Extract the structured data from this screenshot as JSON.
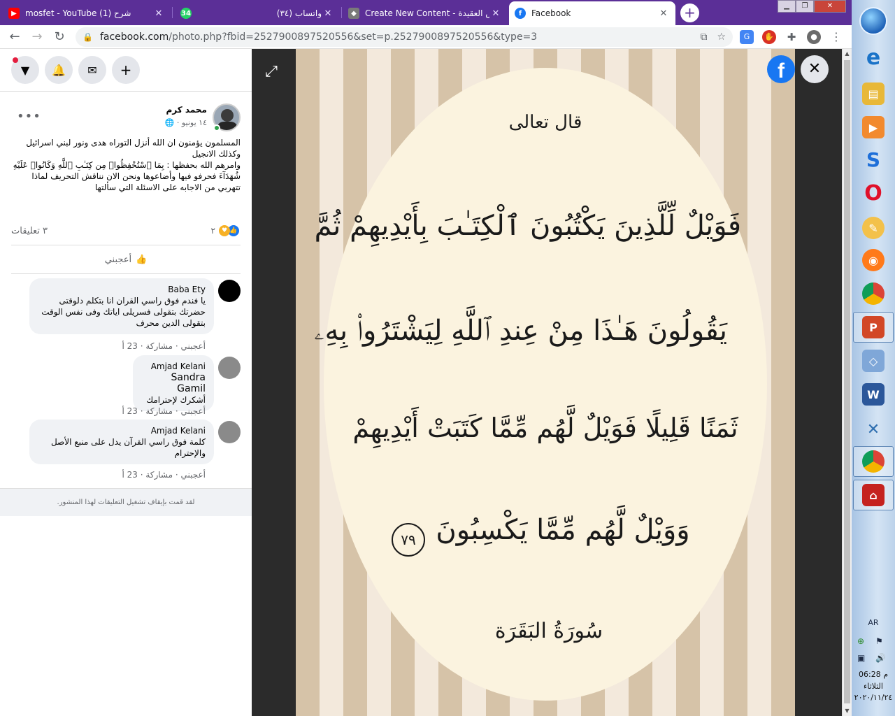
{
  "browser": {
    "tabs": [
      {
        "title": "mosfet - YouTube (1) شرح",
        "icon": "youtube-icon",
        "color": "#ff0000"
      },
      {
        "title": "(٣٤) واتساب",
        "icon": "whatsapp-icon",
        "color": "#25d366"
      },
      {
        "title": "Create New Content - حراس العقيدة",
        "icon": "site-icon",
        "color": "#7a7a7a"
      },
      {
        "title": "Facebook",
        "icon": "facebook-icon",
        "color": "#1877f2"
      }
    ],
    "new_tab": "+",
    "url_host": "facebook.com",
    "url_path": "/photo.php?fbid=2527900897520556&set=p.2527900897520556&type=3"
  },
  "post": {
    "author": "محمد كرم",
    "date": "١٤ يونيو ·",
    "text_lines": [
      "المسلمون يؤمنون ان الله أنزل التوراه هدى ونور لبني اسرائيل وكذلك الانجيل",
      "وامرهم الله بحفظها : بِمَا ٱسْتُحْفِظُوا۟ مِن كِتَـٰبِ ٱللَّهِ وَكَانُوا۟ عَلَيْهِ شُهَدَآءَ فحرفو فيها وأضاعوها ونحن الان نناقش التحريف لماذا تتهربي من الاجابه على الاسئلة التي سألتها"
    ],
    "reaction_count": "٢",
    "comment_count": "٣ تعليقات",
    "like_label": "أعجبني"
  },
  "comments": [
    {
      "author": "Baba Ety",
      "lines": [
        "يا فندم فوق راسي القران انا بتكلم دلوقتى",
        "حضرتك بتقولى فسريلى اياتك وفى نفس الوقت",
        "بتقولى الدين محرف"
      ],
      "meta": "أعجبني · مشاركة · 23 أ"
    },
    {
      "author": "Amjad Kelani",
      "mention": "Sandra Gamil",
      "lines": [
        "أشكرك لإحترامك"
      ],
      "meta": "أعجبني · مشاركة · 23 أ"
    },
    {
      "author": "Amjad Kelani",
      "lines": [
        "كلمة فوق راسي القرآن يدل على منبع الأصل",
        "والإحترام"
      ],
      "meta": "أعجبني · مشاركة · 23 أ"
    }
  ],
  "comments_off": "لقد قمت بإيقاف تشغيل التعليقات لهذا المنشور.",
  "image_text": {
    "heading": "قال تعالى",
    "lines": [
      "فَوَيْلٌ لِّلَّذِينَ يَكْتُبُونَ ٱلْكِتَـٰبَ بِأَيْدِيهِمْ ثُمَّ",
      "يَقُولُونَ هَـٰذَا مِنْ عِندِ ٱللَّهِ لِيَشْتَرُوا۟ بِهِۦ",
      "ثَمَنًا قَلِيلًا فَوَيْلٌ لَّهُم مِّمَّا كَتَبَتْ أَيْدِيهِمْ",
      "وَوَيْلٌ لَّهُم مِّمَّا يَكْسِبُونَ"
    ],
    "verse_number": "٧٩",
    "surah": "سُورَةُ البَقَرَة"
  },
  "taskbar": {
    "lang": "AR",
    "time": "06:28 م",
    "day": "الثلاثاء",
    "date": "٢٠٢٠/١١/٢٤"
  }
}
